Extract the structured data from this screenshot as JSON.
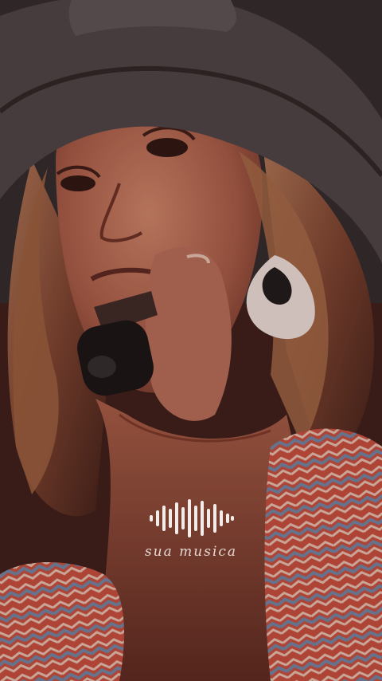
{
  "watermark": {
    "icon": "sound-wave-icon",
    "text": "sua musica",
    "color": "#f4ece8"
  },
  "colors": {
    "hat": "#4a4648",
    "skin": "#b8705a",
    "hair": "#8a5236",
    "shirt_red": "#c04a3c",
    "shirt_blue": "#6f89a8",
    "mic": "#151515"
  }
}
